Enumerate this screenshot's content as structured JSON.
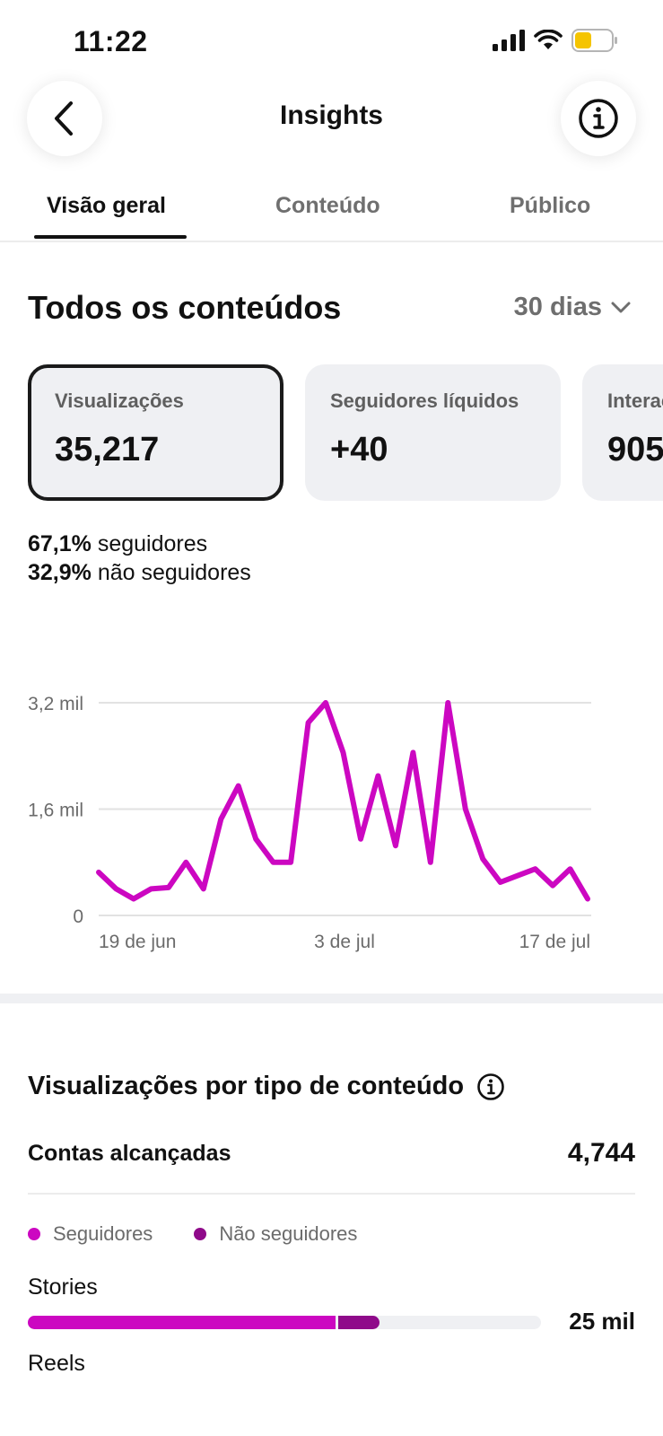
{
  "status_bar": {
    "time": "11:22"
  },
  "header": {
    "title": "Insights"
  },
  "tabs": [
    {
      "label": "Visão geral",
      "active": true
    },
    {
      "label": "Conteúdo",
      "active": false
    },
    {
      "label": "Público",
      "active": false
    }
  ],
  "overview": {
    "title": "Todos os conteúdos",
    "period": "30 dias",
    "cards": [
      {
        "label": "Visualizações",
        "value": "35,217",
        "selected": true
      },
      {
        "label": "Seguidores líquidos",
        "value": "+40",
        "selected": false
      },
      {
        "label": "Interações",
        "value": "905",
        "selected": false
      }
    ],
    "split": [
      {
        "percent": "67,1%",
        "label": "seguidores"
      },
      {
        "percent": "32,9%",
        "label": "não seguidores"
      }
    ]
  },
  "chart_data": {
    "type": "line",
    "y_tick_labels": [
      "3,2 mil",
      "1,6 mil",
      "0"
    ],
    "x_tick_labels": [
      "19 de jun",
      "3 de jul",
      "17 de jul"
    ],
    "ylim": [
      0,
      3200
    ],
    "grid": true,
    "color": "#cc07c1",
    "series": [
      {
        "values": [
          650,
          400,
          250,
          400,
          420,
          800,
          400,
          1450,
          1950,
          1150,
          800,
          800,
          2900,
          3200,
          2450,
          1150,
          2100,
          1050,
          2450,
          800,
          3200,
          1600,
          850,
          500,
          600,
          700,
          450,
          700,
          250
        ]
      }
    ]
  },
  "content_type": {
    "title": "Visualizações por tipo de conteúdo",
    "reach_label": "Contas alcançadas",
    "reach_value": "4,744",
    "legend": [
      {
        "label": "Seguidores",
        "color": "#cc07c1"
      },
      {
        "label": "Não seguidores",
        "color": "#8f0a8a"
      }
    ],
    "rows": [
      {
        "label": "Stories",
        "value": "25 mil",
        "followers_fraction": 0.605,
        "non_followers_fraction": 0.08
      },
      {
        "label": "Reels"
      }
    ]
  },
  "colors": {
    "accent": "#cc07c1",
    "accent_dark": "#8f0a8a",
    "card_bg": "#eff0f3"
  }
}
